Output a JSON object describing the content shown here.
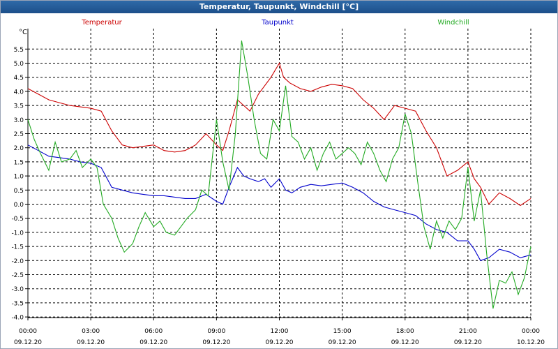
{
  "window": {
    "title": "Temperatur, Taupunkt, Windchill [°C]"
  },
  "chart_data": {
    "type": "line",
    "title": "Temperatur, Taupunkt, Windchill [°C]",
    "ylabel": "°C",
    "ylim": [
      -4.0,
      6.0
    ],
    "yticks": [
      -4.0,
      -3.5,
      -3.0,
      -2.5,
      -2.0,
      -1.5,
      -1.0,
      -0.5,
      0.0,
      0.5,
      1.0,
      1.5,
      2.0,
      2.5,
      3.0,
      3.5,
      4.0,
      4.5,
      5.0,
      5.5
    ],
    "ytick_labels": [
      "-4.0",
      "-3.5",
      "-3.0",
      "-2.5",
      "-2.0",
      "-1.5",
      "-1.0",
      "-0.5",
      "0.0",
      "0.5",
      "1.0",
      "1.5",
      "2.0",
      "2.5",
      "3.0",
      "3.5",
      "4.0",
      "4.5",
      "5.0",
      "5.5"
    ],
    "xlim": [
      0,
      24
    ],
    "xticks": [
      0,
      3,
      6,
      9,
      12,
      15,
      18,
      21,
      24
    ],
    "xtick_time_labels": [
      "00:00",
      "03:00",
      "06:00",
      "09:00",
      "12:00",
      "15:00",
      "18:00",
      "21:00",
      "00:00"
    ],
    "xtick_date_labels": [
      "09.12.20",
      "09.12.20",
      "09.12.20",
      "09.12.20",
      "09.12.20",
      "09.12.20",
      "09.12.20",
      "09.12.20",
      "10.12.20"
    ],
    "grid": true,
    "legend_position": "top",
    "series": [
      {
        "name": "Temperatur",
        "color": "#cc0000",
        "x": [
          0,
          0.5,
          1,
          1.5,
          2,
          2.5,
          3,
          3.5,
          4,
          4.5,
          5,
          5.5,
          6,
          6.5,
          7,
          7.5,
          8,
          8.5,
          9,
          9.3,
          9.6,
          10,
          10.3,
          10.6,
          11,
          11.3,
          11.6,
          12,
          12.2,
          12.5,
          13,
          13.5,
          14,
          14.5,
          15,
          15.5,
          16,
          16.5,
          17,
          17.5,
          18,
          18.5,
          19,
          19.5,
          20,
          20.5,
          21,
          21.3,
          21.6,
          22,
          22.5,
          23,
          23.5,
          24
        ],
        "y": [
          4.1,
          3.9,
          3.7,
          3.6,
          3.5,
          3.45,
          3.4,
          3.3,
          2.6,
          2.1,
          2.0,
          2.05,
          2.1,
          1.9,
          1.85,
          1.9,
          2.1,
          2.5,
          2.1,
          1.9,
          2.6,
          3.7,
          3.5,
          3.3,
          3.9,
          4.2,
          4.5,
          5.0,
          4.5,
          4.3,
          4.1,
          4.0,
          4.15,
          4.25,
          4.2,
          4.1,
          3.7,
          3.4,
          3.0,
          3.5,
          3.4,
          3.3,
          2.6,
          2.0,
          1.0,
          1.2,
          1.5,
          0.9,
          0.6,
          0.0,
          0.4,
          0.2,
          -0.05,
          0.2
        ]
      },
      {
        "name": "Taupunkt",
        "color": "#0000cc",
        "x": [
          0,
          0.5,
          1,
          1.5,
          2,
          2.5,
          3,
          3.5,
          4,
          4.5,
          5,
          5.5,
          6,
          6.5,
          7,
          7.5,
          8,
          8.5,
          9,
          9.3,
          9.6,
          10,
          10.3,
          10.6,
          11,
          11.3,
          11.6,
          12,
          12.3,
          12.6,
          13,
          13.5,
          14,
          14.5,
          15,
          15.5,
          16,
          16.5,
          17,
          17.5,
          18,
          18.5,
          19,
          19.5,
          20,
          20.5,
          21,
          21.3,
          21.6,
          22,
          22.5,
          23,
          23.5,
          24
        ],
        "y": [
          2.1,
          1.9,
          1.7,
          1.65,
          1.6,
          1.5,
          1.45,
          1.3,
          0.6,
          0.5,
          0.4,
          0.35,
          0.3,
          0.3,
          0.25,
          0.2,
          0.2,
          0.35,
          0.1,
          0.0,
          0.6,
          1.3,
          1.0,
          0.9,
          0.8,
          0.9,
          0.6,
          0.9,
          0.5,
          0.4,
          0.6,
          0.7,
          0.65,
          0.7,
          0.75,
          0.6,
          0.4,
          0.1,
          -0.1,
          -0.2,
          -0.3,
          -0.4,
          -0.7,
          -0.9,
          -1.0,
          -1.3,
          -1.3,
          -1.6,
          -2.0,
          -1.9,
          -1.6,
          -1.7,
          -1.9,
          -1.8
        ]
      },
      {
        "name": "Windchill",
        "color": "#22aa22",
        "x": [
          0,
          0.3,
          0.6,
          1,
          1.3,
          1.6,
          2,
          2.3,
          2.6,
          3,
          3.3,
          3.6,
          4,
          4.3,
          4.6,
          5,
          5.3,
          5.6,
          6,
          6.3,
          6.6,
          7,
          7.3,
          7.6,
          8,
          8.3,
          8.6,
          9,
          9.3,
          9.6,
          9.9,
          10.2,
          10.5,
          10.8,
          11.1,
          11.4,
          11.7,
          12,
          12.3,
          12.6,
          12.9,
          13.2,
          13.5,
          13.8,
          14.1,
          14.4,
          14.7,
          15,
          15.3,
          15.6,
          15.9,
          16.2,
          16.5,
          16.8,
          17.1,
          17.4,
          17.7,
          18,
          18.3,
          18.6,
          18.9,
          19.2,
          19.5,
          19.8,
          20.1,
          20.4,
          20.7,
          21,
          21.3,
          21.6,
          21.9,
          22.2,
          22.5,
          22.8,
          23.1,
          23.4,
          23.7,
          24
        ],
        "y": [
          3.0,
          2.3,
          1.8,
          1.2,
          2.2,
          1.5,
          1.6,
          1.9,
          1.3,
          1.6,
          1.3,
          0.0,
          -0.5,
          -1.2,
          -1.7,
          -1.4,
          -0.8,
          -0.3,
          -0.8,
          -0.6,
          -1.0,
          -1.1,
          -0.8,
          -0.5,
          -0.2,
          0.5,
          0.3,
          3.0,
          1.5,
          0.5,
          2.5,
          5.8,
          4.5,
          3.0,
          1.8,
          1.6,
          3.0,
          2.6,
          4.2,
          2.4,
          2.2,
          1.6,
          2.0,
          1.2,
          1.8,
          2.2,
          1.6,
          1.8,
          2.0,
          1.8,
          1.4,
          2.2,
          1.8,
          1.2,
          0.8,
          1.6,
          2.0,
          3.2,
          2.5,
          0.8,
          -0.8,
          -1.6,
          -0.6,
          -1.2,
          -0.6,
          -0.9,
          -0.5,
          1.3,
          -0.6,
          0.5,
          -1.8,
          -3.7,
          -2.7,
          -2.8,
          -2.4,
          -3.2,
          -2.6,
          -1.5
        ]
      }
    ]
  }
}
